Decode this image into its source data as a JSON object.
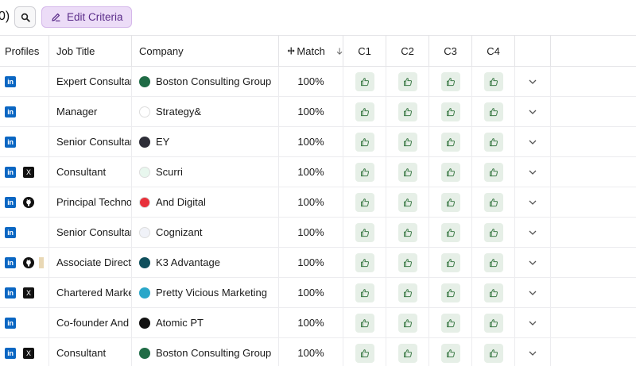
{
  "toolbar": {
    "count_fragment": "0)",
    "edit_criteria_label": "Edit Criteria"
  },
  "columns": {
    "profiles": "Profiles",
    "job_title": "Job Title",
    "company": "Company",
    "match": "Match",
    "c1": "C1",
    "c2": "C2",
    "c3": "C3",
    "c4": "C4"
  },
  "colors": {
    "accent_purple": "#ecdcf7",
    "linkedin": "#0a66c2",
    "thumb_bg": "#e6efe7",
    "thumb_icon": "#3f7d4a"
  },
  "rows": [
    {
      "profiles": [
        "linkedin-icon"
      ],
      "job_title": "Expert Consultant",
      "company": "Boston Consulting Group",
      "company_logo": "bcg-logo",
      "logo_color": "#1f6b45",
      "match": "100%"
    },
    {
      "profiles": [
        "linkedin-icon"
      ],
      "job_title": "Manager",
      "company": "Strategy&",
      "company_logo": "strategy-and-logo",
      "logo_color": "#ffffff",
      "match": "100%"
    },
    {
      "profiles": [
        "linkedin-icon"
      ],
      "job_title": "Senior Consultant",
      "company": "EY",
      "company_logo": "ey-logo",
      "logo_color": "#2e2e38",
      "match": "100%"
    },
    {
      "profiles": [
        "linkedin-icon",
        "x-icon"
      ],
      "job_title": "Consultant",
      "company": "Scurri",
      "company_logo": "scurri-logo",
      "logo_color": "#e8f7ee",
      "match": "100%"
    },
    {
      "profiles": [
        "linkedin-icon",
        "github-icon"
      ],
      "job_title": "Principal Technologist",
      "company": "And Digital",
      "company_logo": "and-digital-logo",
      "logo_color": "#e8303a",
      "match": "100%"
    },
    {
      "profiles": [
        "linkedin-icon"
      ],
      "job_title": "Senior Consultant",
      "company": "Cognizant",
      "company_logo": "cognizant-logo",
      "logo_color": "#f0f2f8",
      "match": "100%"
    },
    {
      "profiles": [
        "linkedin-icon",
        "github-icon",
        "extra-icon"
      ],
      "job_title": "Associate Director",
      "company": "K3 Advantage",
      "company_logo": "k3-logo",
      "logo_color": "#0f4f5c",
      "match": "100%"
    },
    {
      "profiles": [
        "linkedin-icon",
        "x-icon"
      ],
      "job_title": "Chartered Marketer",
      "company": "Pretty Vicious Marketing",
      "company_logo": "pvm-logo",
      "logo_color": "#2aa7c9",
      "match": "100%"
    },
    {
      "profiles": [
        "linkedin-icon"
      ],
      "job_title": "Co-founder And Head",
      "company": "Atomic PT",
      "company_logo": "atomic-pt-logo",
      "logo_color": "#111111",
      "match": "100%"
    },
    {
      "profiles": [
        "linkedin-icon",
        "x-icon"
      ],
      "job_title": "Consultant",
      "company": "Boston Consulting Group",
      "company_logo": "bcg-logo",
      "logo_color": "#1f6b45",
      "match": "100%"
    }
  ]
}
